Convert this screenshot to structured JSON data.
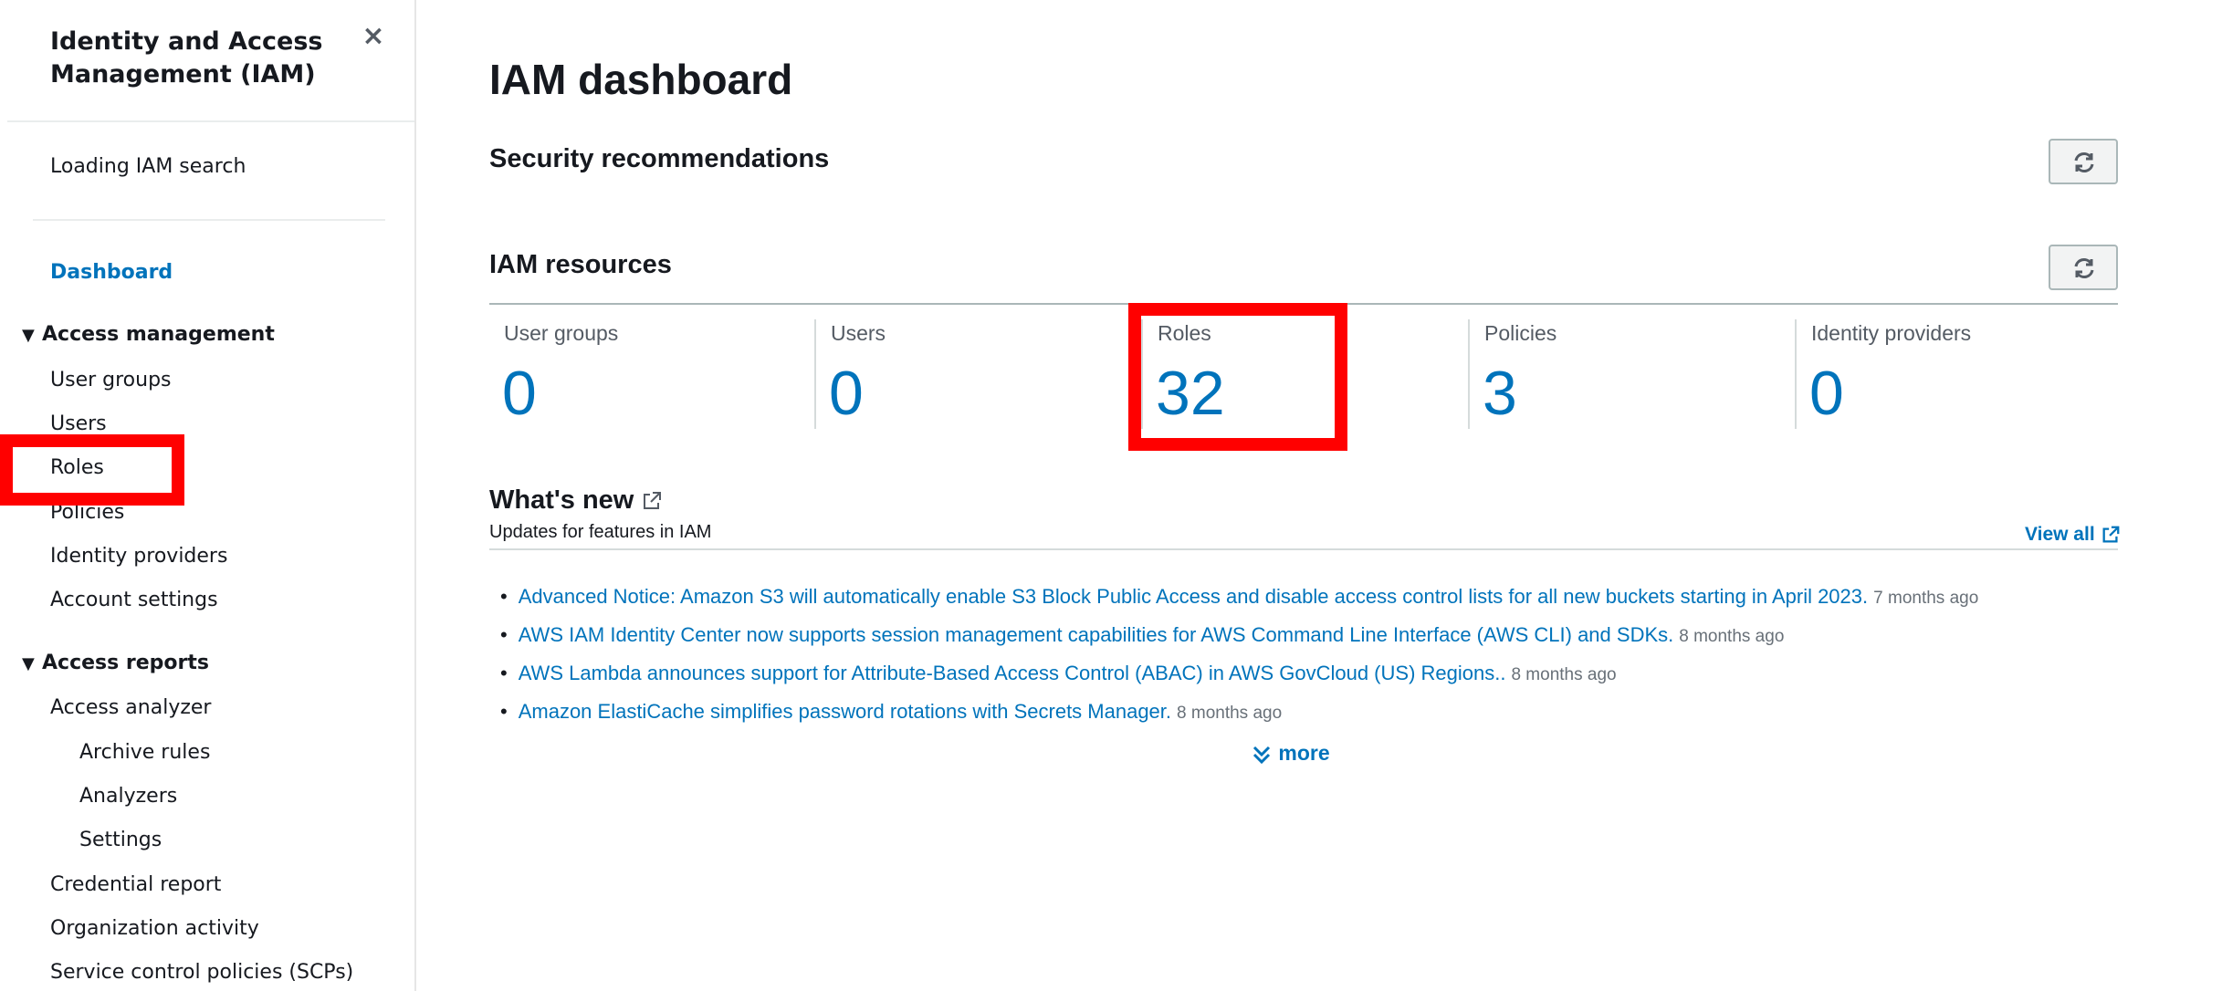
{
  "sidebar": {
    "title": "Identity and Access Management (IAM)",
    "close_icon": "×",
    "search_text": "Loading IAM search",
    "dashboard_label": "Dashboard",
    "access_management": {
      "label": "Access management",
      "items": [
        "User groups",
        "Users",
        "Roles",
        "Policies",
        "Identity providers",
        "Account settings"
      ]
    },
    "access_reports": {
      "label": "Access reports",
      "items": [
        "Access analyzer",
        "Archive rules",
        "Analyzers",
        "Settings",
        "Credential report",
        "Organization activity",
        "Service control policies (SCPs)"
      ]
    }
  },
  "main": {
    "title": "IAM dashboard",
    "security_recommendations": "Security recommendations",
    "iam_resources": {
      "title": "IAM resources",
      "cards": [
        {
          "label": "User groups",
          "count": "0"
        },
        {
          "label": "Users",
          "count": "0"
        },
        {
          "label": "Roles",
          "count": "32"
        },
        {
          "label": "Policies",
          "count": "3"
        },
        {
          "label": "Identity providers",
          "count": "0"
        }
      ]
    },
    "whats_new": {
      "title": "What's new",
      "subtitle": "Updates for features in IAM",
      "view_all": "View all",
      "items": [
        {
          "text": "Advanced Notice: Amazon S3 will automatically enable S3 Block Public Access and disable access control lists for all new buckets starting in April 2023.",
          "ago": "7 months ago"
        },
        {
          "text": "AWS IAM Identity Center now supports session management capabilities for AWS Command Line Interface (AWS CLI) and SDKs.",
          "ago": "8 months ago"
        },
        {
          "text": "AWS Lambda announces support for Attribute-Based Access Control (ABAC) in AWS GovCloud (US) Regions..",
          "ago": "8 months ago"
        },
        {
          "text": "Amazon ElastiCache simplifies password rotations with Secrets Manager.",
          "ago": "8 months ago"
        }
      ],
      "more": "more"
    }
  },
  "colors": {
    "link": "#0073bb",
    "highlight": "#ff0000",
    "text": "#16191f"
  },
  "icons": {
    "close": "close-icon",
    "refresh": "refresh-icon",
    "external": "external-link-icon",
    "more": "double-chevron-down-icon",
    "expand": "caret-down-icon"
  }
}
